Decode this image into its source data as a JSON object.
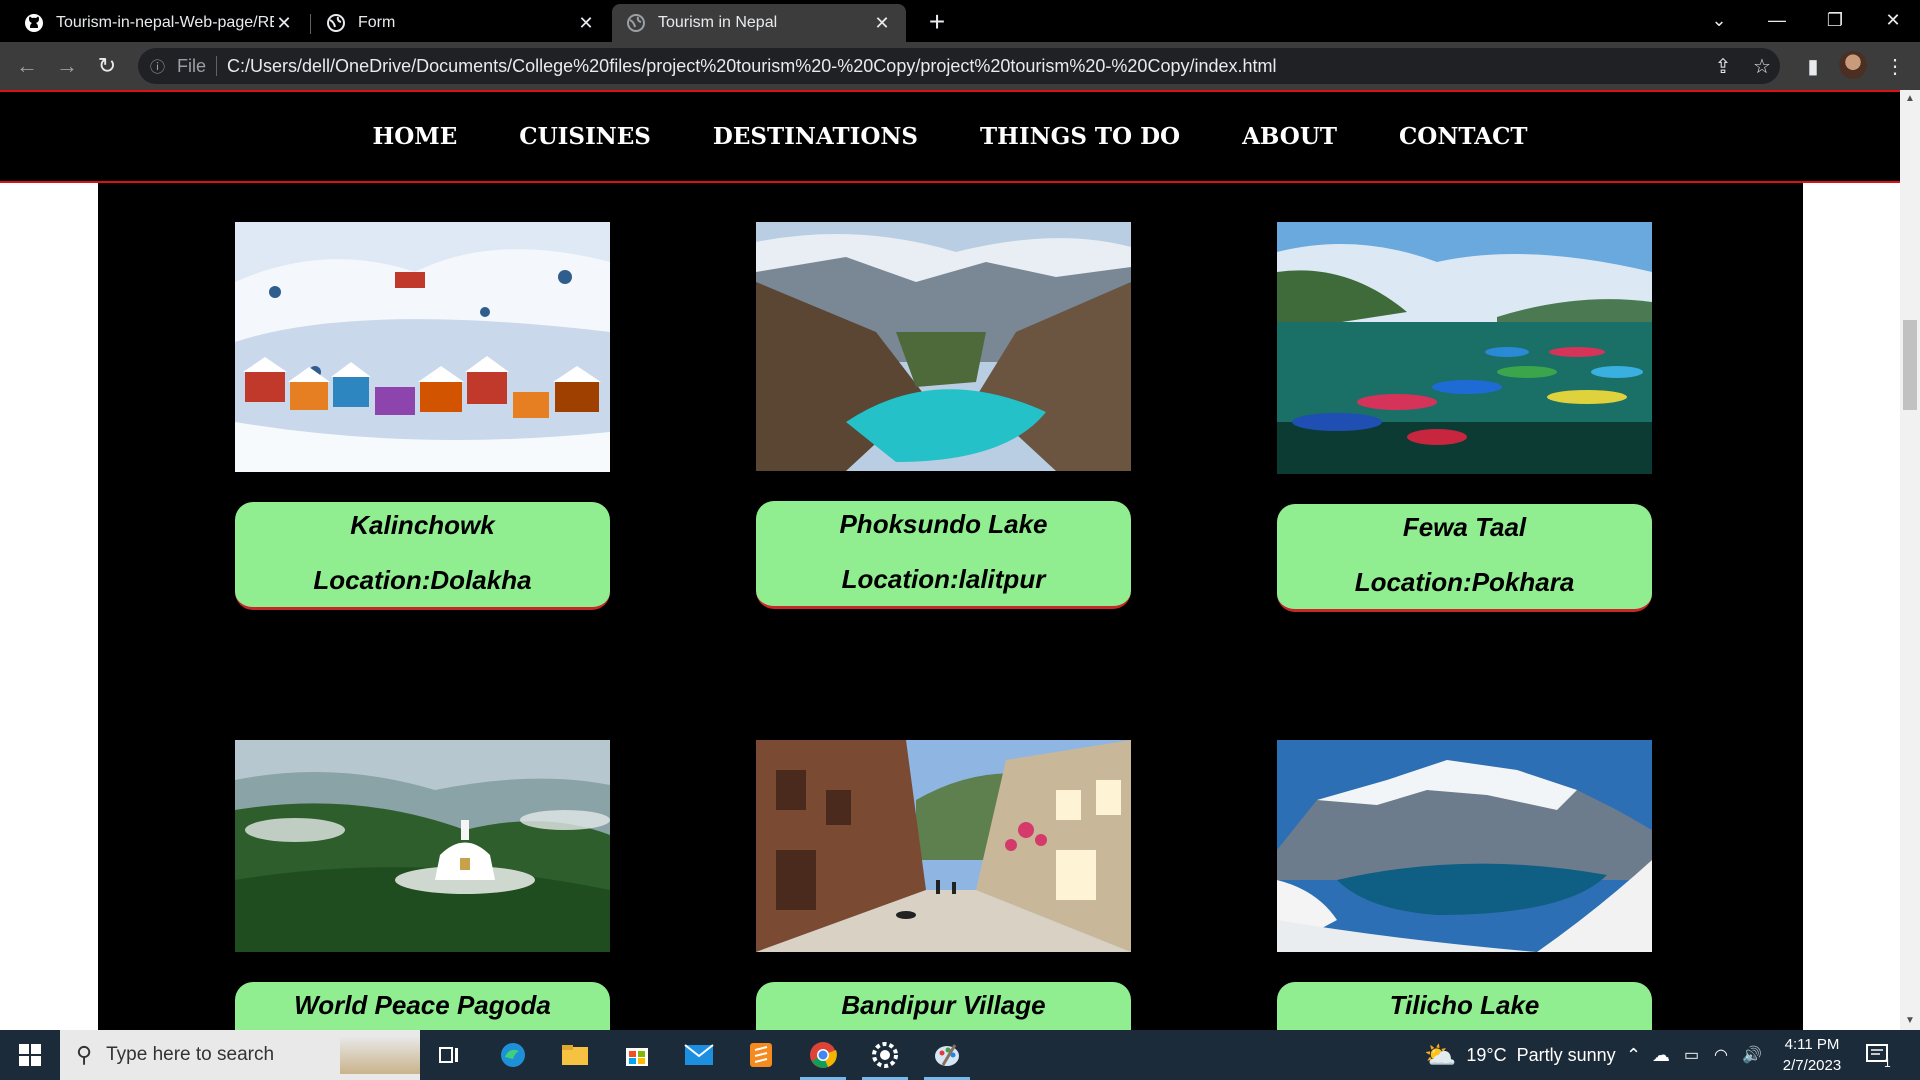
{
  "browser": {
    "tabs": [
      {
        "title": "Tourism-in-nepal-Web-page/REA",
        "icon": "github-icon",
        "active": false
      },
      {
        "title": "Form",
        "icon": "globe-icon",
        "active": false
      },
      {
        "title": "Tourism in Nepal",
        "icon": "globe-icon",
        "active": true
      }
    ],
    "address": {
      "scheme_label": "File",
      "url": "C:/Users/dell/OneDrive/Documents/College%20files/project%20tourism%20-%20Copy/project%20tourism%20-%20Copy/index.html"
    }
  },
  "nav": {
    "items": [
      "HOME",
      "CUISINES",
      "DESTINATIONS",
      "THINGS TO DO",
      "ABOUT",
      "CONTACT"
    ]
  },
  "destinations": [
    {
      "name": "Kalinchowk",
      "location": "Location:Dolakha",
      "image": "snowy-village-photo"
    },
    {
      "name": "Phoksundo Lake",
      "location": "Location:lalitpur",
      "image": "turquoise-lake-photo"
    },
    {
      "name": "Fewa Taal",
      "location": "Location:Pokhara",
      "image": "lake-boats-photo"
    },
    {
      "name": "World Peace Pagoda",
      "location": "",
      "image": "stupa-hill-photo"
    },
    {
      "name": "Bandipur Village",
      "location": "",
      "image": "village-street-photo"
    },
    {
      "name": "Tilicho Lake",
      "location": "",
      "image": "glacier-lake-photo"
    }
  ],
  "taskbar": {
    "search_placeholder": "Type here to search",
    "weather": "19°C  Partly sunny",
    "time": "4:11 PM",
    "date": "2/7/2023",
    "notification_count": "1"
  },
  "colors": {
    "card_green": "#90ee90",
    "accent_red": "#d11111",
    "nav_bg": "#000000"
  }
}
